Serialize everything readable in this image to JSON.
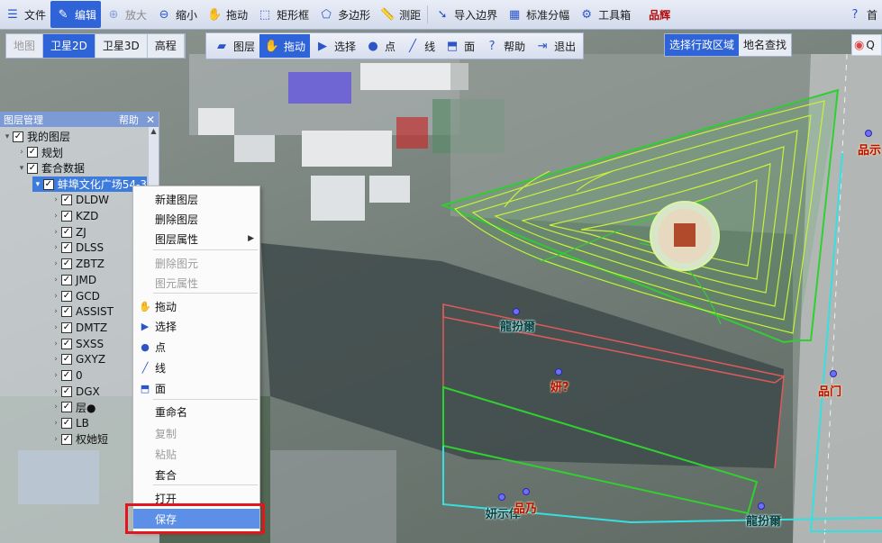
{
  "toolbar": {
    "items": [
      {
        "label": "文件",
        "icon": "file-icon",
        "state": "normal"
      },
      {
        "label": "编辑",
        "icon": "edit-icon",
        "state": "active"
      },
      {
        "label": "放大",
        "icon": "zoom-in-icon",
        "state": "dim"
      },
      {
        "label": "缩小",
        "icon": "zoom-out-icon",
        "state": "normal"
      },
      {
        "label": "拖动",
        "icon": "hand-icon",
        "state": "normal"
      },
      {
        "label": "矩形框",
        "icon": "rectangle-select-icon",
        "state": "normal"
      },
      {
        "label": "多边形",
        "icon": "polygon-select-icon",
        "state": "normal"
      },
      {
        "label": "测距",
        "icon": "ruler-icon",
        "state": "normal"
      },
      {
        "label": "导入边界",
        "icon": "import-boundary-icon",
        "state": "normal"
      },
      {
        "label": "标准分幅",
        "icon": "grid-icon",
        "state": "normal"
      },
      {
        "label": "工具箱",
        "icon": "gear-icon",
        "state": "normal"
      }
    ],
    "overlay_red_label": "品辉",
    "help_icon": "help-icon",
    "home_label": "首"
  },
  "maptype": {
    "items": [
      {
        "label": "地图",
        "state": "dim"
      },
      {
        "label": "卫星2D",
        "state": "active"
      },
      {
        "label": "卫星3D",
        "state": "normal"
      },
      {
        "label": "高程",
        "state": "normal"
      }
    ]
  },
  "tools": {
    "items": [
      {
        "label": "图层",
        "icon": "layers-icon",
        "state": "normal"
      },
      {
        "label": "拖动",
        "icon": "hand-icon",
        "state": "active"
      },
      {
        "label": "选择",
        "icon": "cursor-icon",
        "state": "normal"
      },
      {
        "label": "点",
        "icon": "point-pin-icon",
        "state": "normal"
      },
      {
        "label": "线",
        "icon": "line-icon",
        "state": "normal"
      },
      {
        "label": "面",
        "icon": "polygon-icon",
        "state": "normal"
      },
      {
        "label": "帮助",
        "icon": "help-icon",
        "state": "normal"
      },
      {
        "label": "退出",
        "icon": "exit-icon",
        "state": "normal"
      }
    ]
  },
  "region": {
    "items": [
      {
        "label": "选择行政区域",
        "state": "active"
      },
      {
        "label": "地名查找",
        "state": "normal"
      }
    ],
    "qq_label": "Q"
  },
  "layer_panel": {
    "title": "图层管理",
    "help": "帮助",
    "close": "✕",
    "tree": [
      {
        "label": "我的图层",
        "level": 0,
        "expanded": true,
        "checked": true
      },
      {
        "label": "规划",
        "level": 1,
        "expanded": false,
        "checked": true
      },
      {
        "label": "套合数据",
        "level": 1,
        "expanded": true,
        "checked": true
      },
      {
        "label": "蚌埠文化广场54-3",
        "level": 2,
        "expanded": true,
        "checked": true,
        "selected": true
      },
      {
        "label": "DLDW",
        "level": 3,
        "expanded": false,
        "checked": true
      },
      {
        "label": "KZD",
        "level": 3,
        "expanded": false,
        "checked": true
      },
      {
        "label": "ZJ",
        "level": 3,
        "expanded": false,
        "checked": true
      },
      {
        "label": "DLSS",
        "level": 3,
        "expanded": false,
        "checked": true
      },
      {
        "label": "ZBTZ",
        "level": 3,
        "expanded": false,
        "checked": true
      },
      {
        "label": "JMD",
        "level": 3,
        "expanded": false,
        "checked": true
      },
      {
        "label": "GCD",
        "level": 3,
        "expanded": false,
        "checked": true
      },
      {
        "label": "ASSIST",
        "level": 3,
        "expanded": false,
        "checked": true
      },
      {
        "label": "DMTZ",
        "level": 3,
        "expanded": false,
        "checked": true
      },
      {
        "label": "SXSS",
        "level": 3,
        "expanded": false,
        "checked": true
      },
      {
        "label": "GXYZ",
        "level": 3,
        "expanded": false,
        "checked": true
      },
      {
        "label": "0",
        "level": 3,
        "expanded": false,
        "checked": true
      },
      {
        "label": "DGX",
        "level": 3,
        "expanded": false,
        "checked": true
      },
      {
        "label": "层●",
        "level": 3,
        "expanded": false,
        "checked": true
      },
      {
        "label": "LB",
        "level": 3,
        "expanded": false,
        "checked": true
      },
      {
        "label": "权她短",
        "level": 3,
        "expanded": false,
        "checked": true
      }
    ]
  },
  "context_menu": {
    "items": [
      {
        "label": "新建图层",
        "state": "normal"
      },
      {
        "label": "删除图层",
        "state": "normal"
      },
      {
        "label": "图层属性",
        "state": "normal",
        "submenu": true
      },
      {
        "label": "删除图元",
        "state": "dim"
      },
      {
        "label": "图元属性",
        "state": "dim"
      },
      {
        "label": "拖动",
        "state": "normal",
        "icon": "hand-icon"
      },
      {
        "label": "选择",
        "state": "normal",
        "icon": "cursor-icon"
      },
      {
        "label": "点",
        "state": "normal",
        "icon": "point-pin-icon"
      },
      {
        "label": "线",
        "state": "normal",
        "icon": "line-icon"
      },
      {
        "label": "面",
        "state": "normal",
        "icon": "polygon-icon"
      },
      {
        "label": "重命名",
        "state": "normal"
      },
      {
        "label": "复制",
        "state": "dim"
      },
      {
        "label": "粘贴",
        "state": "dim"
      },
      {
        "label": "套合",
        "state": "normal"
      },
      {
        "label": "打开",
        "state": "normal"
      },
      {
        "label": "保存",
        "state": "highlighted"
      }
    ]
  },
  "map_labels": {
    "label_1": "龍扮爾",
    "label_2": "妍?",
    "label_3": "妍示倖",
    "label_4": "品乃",
    "label_5": "龍扮爾",
    "label_6": "品门",
    "label_7": "品示"
  },
  "colors": {
    "accent": "#2f63d8",
    "contour": "#c9f03a",
    "boundary_green": "#2fd12f",
    "boundary_red": "#e05a5a",
    "boundary_cyan": "#36e0e0",
    "highlight_box": "#e3161c"
  }
}
